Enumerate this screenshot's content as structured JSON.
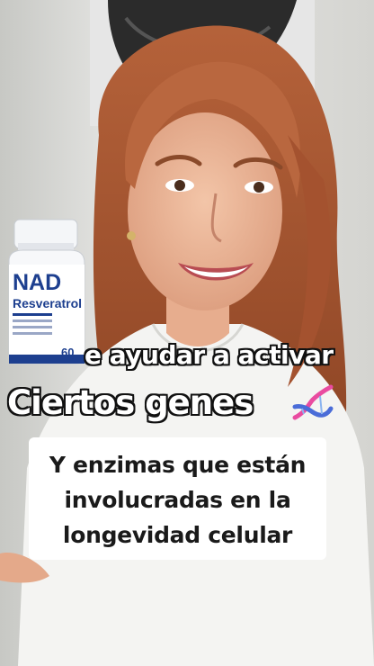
{
  "video": {
    "captions": {
      "line1": "e ayudar a activar",
      "line2": "Ciertos genes"
    },
    "overlay_box": {
      "line1": "Y enzimas que están",
      "line2": "involucradas en la",
      "line3": "longevidad celular"
    },
    "product": {
      "name": "NAD",
      "subname": "Resveratrol",
      "count": "60"
    }
  }
}
